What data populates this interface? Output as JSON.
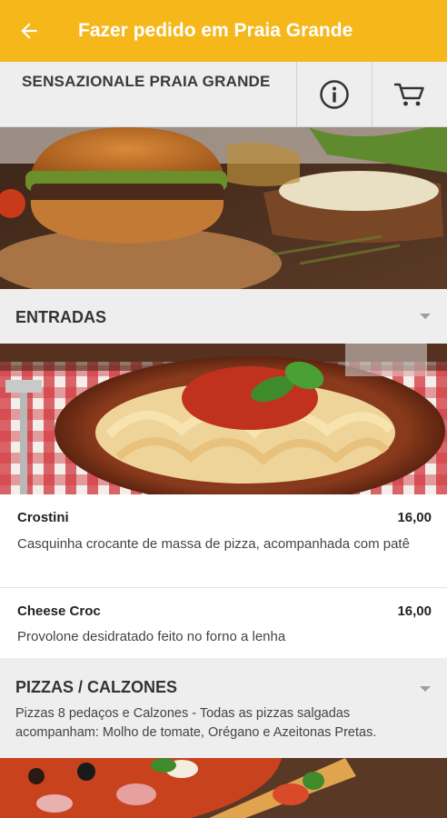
{
  "appbar": {
    "title": "Fazer pedido em Praia Grande",
    "back_icon": "arrow-left-icon"
  },
  "store": {
    "name": "SENSAZIONALE PRAIA GRANDE",
    "info_icon": "info-icon",
    "cart_icon": "cart-icon"
  },
  "colors": {
    "accent": "#F6B71B",
    "section_bg": "#EEEEEE"
  },
  "sections": [
    {
      "title": "ENTRADAS",
      "description": "",
      "items": [
        {
          "name": "Crostini",
          "price": "16,00",
          "description": "Casquinha crocante de massa de pizza, acompanhada com patê"
        },
        {
          "name": "Cheese Croc",
          "price": "16,00",
          "description": "Provolone desidratado feito no forno a lenha"
        }
      ]
    },
    {
      "title": "PIZZAS / CALZONES",
      "description": "Pizzas 8 pedaços e Calzones - Todas as pizzas salgadas acompanham: Molho de tomate, Orégano e Azeitonas Pretas."
    }
  ]
}
